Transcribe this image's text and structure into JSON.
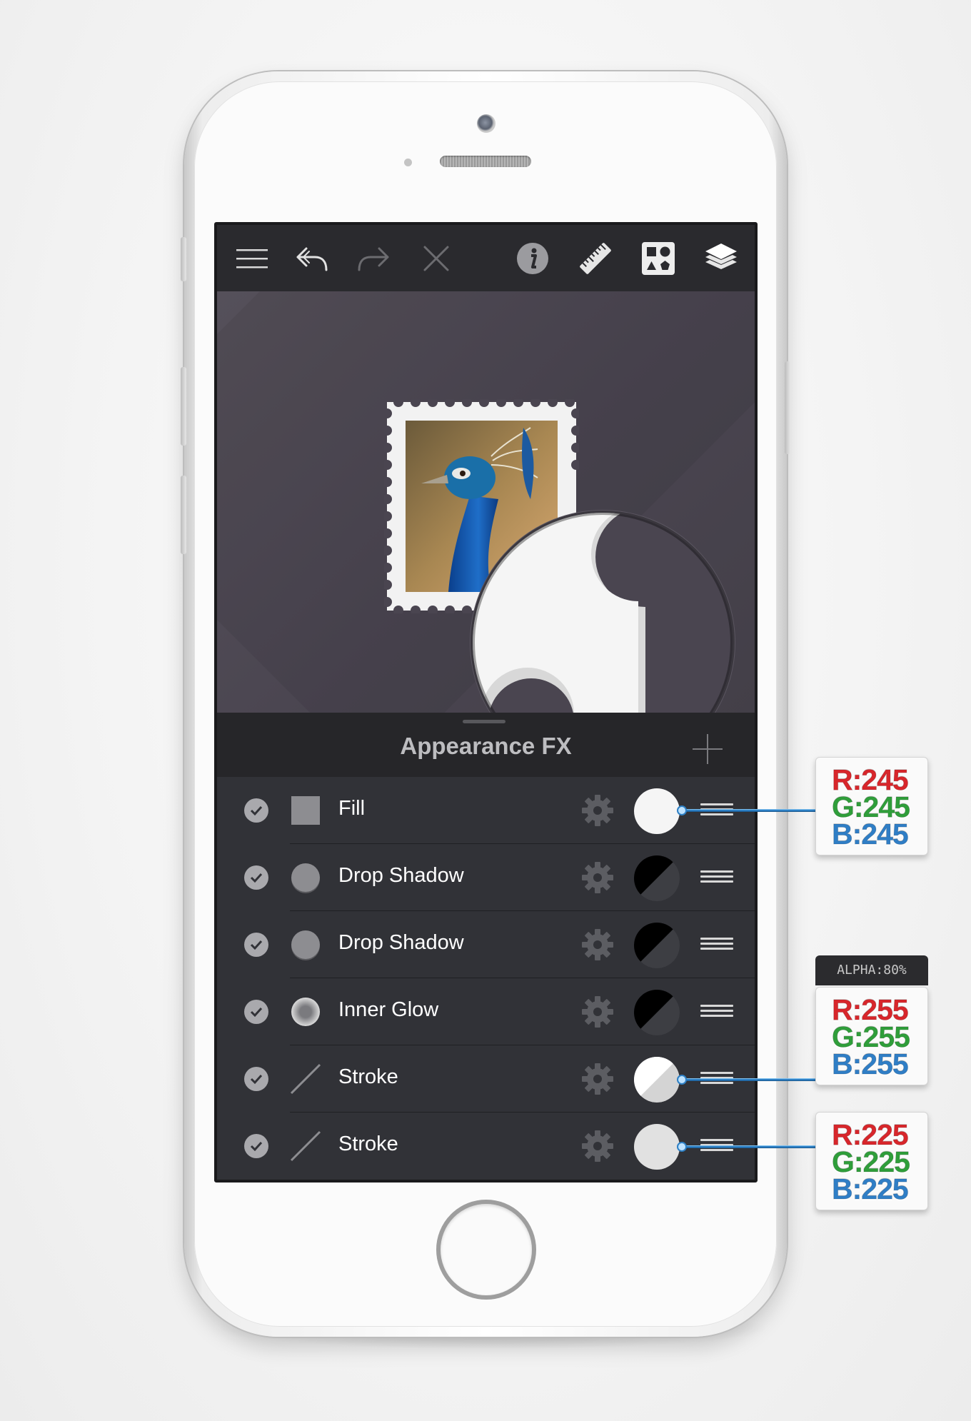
{
  "toolbar": {
    "icons": [
      "menu-icon",
      "undo-icon",
      "redo-icon",
      "close-icon",
      "info-icon",
      "ruler-icon",
      "library-icon",
      "layers-icon"
    ]
  },
  "panel": {
    "title": "Appearance FX"
  },
  "effects": [
    {
      "enabled": true,
      "type_icon": "square-fill-icon",
      "name": "Fill",
      "swatch": "white"
    },
    {
      "enabled": true,
      "type_icon": "circle-shadow-icon",
      "name": "Drop Shadow",
      "swatch": "black-diagonal"
    },
    {
      "enabled": true,
      "type_icon": "circle-shadow-icon",
      "name": "Drop Shadow",
      "swatch": "black-diagonal"
    },
    {
      "enabled": true,
      "type_icon": "circle-glow-icon",
      "name": "Inner Glow",
      "swatch": "black-diagonal"
    },
    {
      "enabled": true,
      "type_icon": "stroke-line-icon",
      "name": "Stroke",
      "swatch": "white-diagonal"
    },
    {
      "enabled": true,
      "type_icon": "stroke-line-icon",
      "name": "Stroke",
      "swatch": "light-gray"
    }
  ],
  "callouts": {
    "fill": {
      "r": "R:245",
      "g": "G:245",
      "b": "B:245"
    },
    "stroke1": {
      "alpha": "ALPHA:80%",
      "r": "R:255",
      "g": "G:255",
      "b": "B:255"
    },
    "stroke2": {
      "r": "R:225",
      "g": "G:225",
      "b": "B:225"
    }
  },
  "colors": {
    "toolbar_bg": "#2a2a2e",
    "canvas_bg": "#4a4550",
    "row_bg": "#313237",
    "accent_blue": "#2d7fc4"
  }
}
